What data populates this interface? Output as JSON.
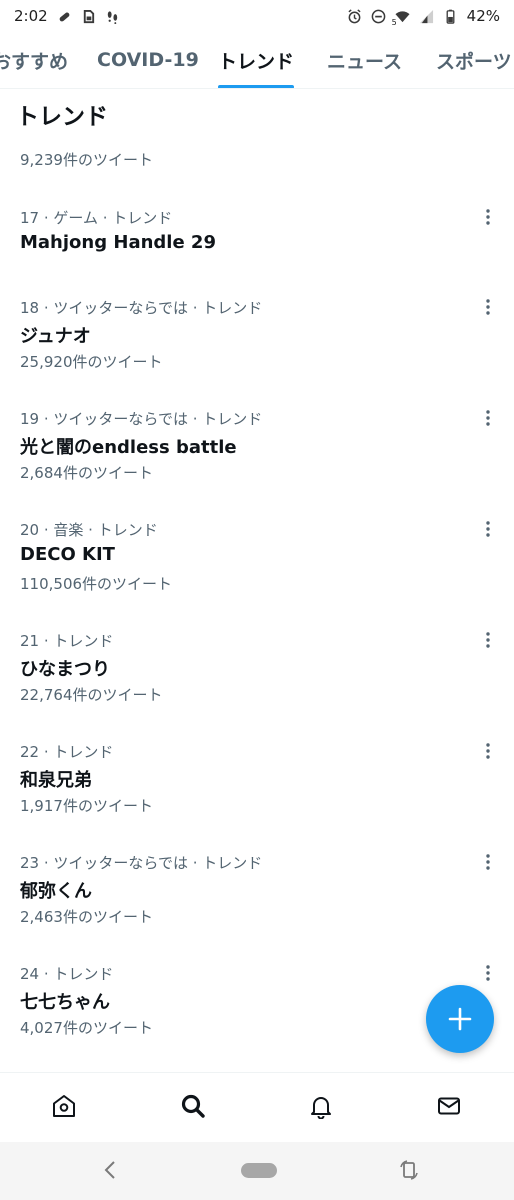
{
  "status_bar": {
    "time": "2:02",
    "battery": "42%",
    "wifi_badge": "5",
    "icons_left": [
      "bandage-icon",
      "sim-icon",
      "footsteps-icon"
    ],
    "icons_right": [
      "alarm-icon",
      "dnd-icon",
      "wifi-icon",
      "signal-icon",
      "battery-icon"
    ]
  },
  "tabs": [
    {
      "label": "おすすめ",
      "active": false
    },
    {
      "label": "COVID-19",
      "active": false
    },
    {
      "label": "トレンド",
      "active": true
    },
    {
      "label": "ニュース",
      "active": false
    },
    {
      "label": "スポーツ",
      "active": false
    }
  ],
  "section": {
    "title": "トレンド",
    "carry_over_count": "9,239件のツイート"
  },
  "trends": [
    {
      "meta": "17 · ゲーム · トレンド",
      "name": "Mahjong Handle 29",
      "count": ""
    },
    {
      "meta": "18 · ツイッターならでは · トレンド",
      "name": "ジュナオ",
      "count": "25,920件のツイート"
    },
    {
      "meta": "19 · ツイッターならでは · トレンド",
      "name": "光と闇のendless battle",
      "count": "2,684件のツイート"
    },
    {
      "meta": "20 · 音楽 · トレンド",
      "name": "DECO KIT",
      "count": "110,506件のツイート"
    },
    {
      "meta": "21 · トレンド",
      "name": "ひなまつり",
      "count": "22,764件のツイート"
    },
    {
      "meta": "22 · トレンド",
      "name": "和泉兄弟",
      "count": "1,917件のツイート"
    },
    {
      "meta": "23 · ツイッターならでは · トレンド",
      "name": "郁弥くん",
      "count": "2,463件のツイート"
    },
    {
      "meta": "24 · トレンド",
      "name": "七七ちゃん",
      "count": "4,027件のツイート"
    }
  ],
  "fab": {
    "icon": "plus-icon"
  },
  "bottom_nav": [
    {
      "name": "home",
      "icon": "home-icon",
      "active": false
    },
    {
      "name": "search",
      "icon": "search-icon",
      "active": true
    },
    {
      "name": "notifications",
      "icon": "bell-icon",
      "active": false
    },
    {
      "name": "messages",
      "icon": "mail-icon",
      "active": false
    }
  ],
  "system_nav": [
    "back-icon",
    "home-pill",
    "rotate-icon"
  ],
  "colors": {
    "accent": "#1d9bf0",
    "primary_text": "#0f1419",
    "secondary_text": "#536471",
    "divider": "#eff3f4"
  }
}
